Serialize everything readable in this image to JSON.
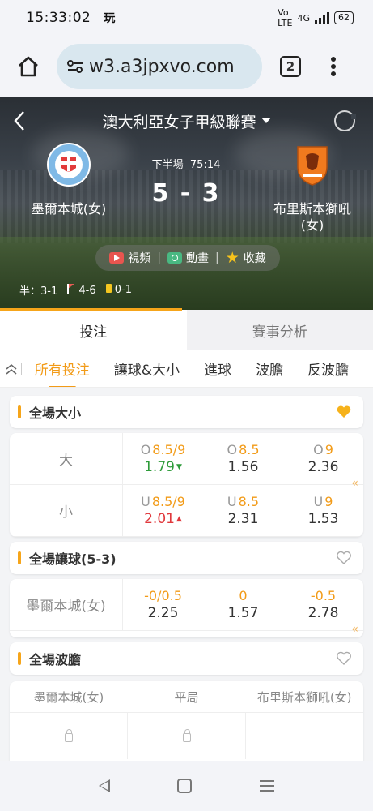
{
  "status_bar": {
    "time": "15:33:02",
    "app_glyph": "玩",
    "network": "4G",
    "battery": "62"
  },
  "browser": {
    "url": "w3.a3jpxvo.com",
    "tab_count": "2"
  },
  "match": {
    "league": "澳大利亞女子甲級聯賽",
    "period": "下半場",
    "clock": "75:14",
    "home_team": "墨爾本城(女)",
    "away_team_line1": "布里斯本獅吼",
    "away_team_line2": "(女)",
    "score_home": "5",
    "score_sep": "-",
    "score_away": "3",
    "actions": {
      "video": "視頻",
      "animation": "動畫",
      "favorite": "收藏"
    },
    "stats": {
      "half_label": "半：3-1",
      "corners": "4-6",
      "cards": "0-1"
    }
  },
  "main_tabs": {
    "bet": "投注",
    "analysis": "賽事分析"
  },
  "sub_tabs": [
    "所有投注",
    "讓球&大小",
    "進球",
    "波膽",
    "反波膽"
  ],
  "markets": {
    "total": {
      "title": "全場大小",
      "rows": [
        {
          "label": "大",
          "cells": [
            {
              "prefix": "O",
              "line": "8.5/9",
              "odd": "1.79",
              "trend": "down"
            },
            {
              "prefix": "O",
              "line": "8.5",
              "odd": "1.56",
              "trend": ""
            },
            {
              "prefix": "O",
              "line": "9",
              "odd": "2.36",
              "trend": ""
            }
          ]
        },
        {
          "label": "小",
          "cells": [
            {
              "prefix": "U",
              "line": "8.5/9",
              "odd": "2.01",
              "trend": "up"
            },
            {
              "prefix": "U",
              "line": "8.5",
              "odd": "2.31",
              "trend": ""
            },
            {
              "prefix": "U",
              "line": "9",
              "odd": "1.53",
              "trend": ""
            }
          ]
        }
      ]
    },
    "handicap": {
      "title": "全場讓球(5-3)",
      "rows": [
        {
          "label": "墨爾本城(女)",
          "cells": [
            {
              "prefix": "",
              "line": "-0/0.5",
              "odd": "2.25",
              "trend": ""
            },
            {
              "prefix": "",
              "line": "0",
              "odd": "1.57",
              "trend": ""
            },
            {
              "prefix": "",
              "line": "-0.5",
              "odd": "2.78",
              "trend": ""
            }
          ]
        }
      ]
    },
    "correct_score": {
      "title": "全場波膽",
      "headers": [
        "墨爾本城(女)",
        "平局",
        "布里斯本獅吼(女)"
      ]
    }
  },
  "colors": {
    "accent": "#f29b18",
    "up": "#e0383c",
    "down": "#2e9b3a",
    "heart_active": "#f6b21b"
  }
}
